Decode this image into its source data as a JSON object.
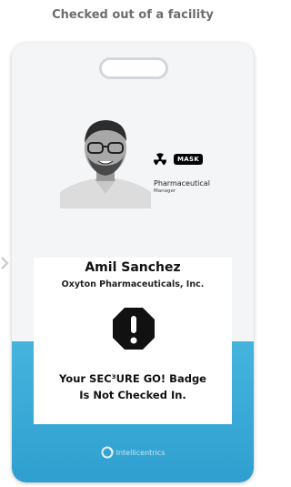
{
  "caption": "Checked out of a facility",
  "badge": {
    "icons": [
      "radiation-icon",
      "mask-badge"
    ],
    "mask_label": "MASK",
    "department": "Pharmaceutical",
    "role": "Manager",
    "person_name": "Amil Sanchez",
    "company": "Oxyton Pharmaceuticals, Inc.",
    "status_line1": "Your SEC³URE GO! Badge",
    "status_line2": "Is Not Checked In.",
    "footer_brand": "Intellicentrics"
  },
  "colors": {
    "accent_blue": "#3aa9d6",
    "alert_black": "#111111"
  }
}
